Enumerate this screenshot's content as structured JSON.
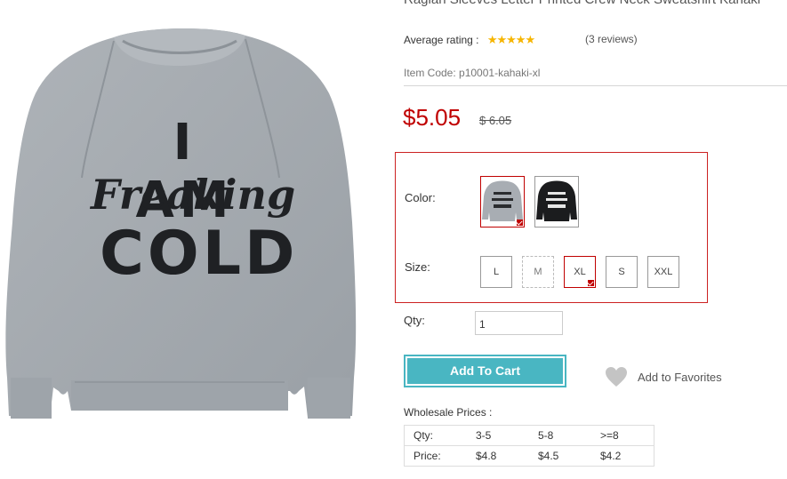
{
  "product": {
    "title": "Raglan Sleeves Letter Printed Crew Neck Sweatshirt Kahaki",
    "image_text": [
      "I AM",
      "Freaking",
      "COLD"
    ]
  },
  "rating": {
    "label": "Average rating :",
    "stars_value": 5,
    "stars_max": 5,
    "stars_display": "★★★★★",
    "reviews": "(3 reviews)"
  },
  "item_code": "Item Code: p10001-kahaki-xl",
  "price": {
    "current": "$5.05",
    "original": "$ 6.05"
  },
  "options": {
    "color_label": "Color:",
    "colors": [
      {
        "name": "gray",
        "selected": true,
        "print": [
          "I AM",
          "Freaking",
          "COLD"
        ]
      },
      {
        "name": "black",
        "selected": false,
        "print": [
          "I AM",
          "Freaking",
          "COLD"
        ]
      }
    ],
    "size_label": "Size:",
    "sizes": [
      {
        "label": "L",
        "state": "normal"
      },
      {
        "label": "M",
        "state": "disabled"
      },
      {
        "label": "XL",
        "state": "selected"
      },
      {
        "label": "S",
        "state": "normal"
      },
      {
        "label": "XXL",
        "state": "normal"
      }
    ]
  },
  "qty": {
    "label": "Qty:",
    "value": "1"
  },
  "cart": {
    "label": "Add To Cart"
  },
  "favorites": {
    "label": "Add to Favorites",
    "icon": "heart-icon"
  },
  "wholesale": {
    "title": "Wholesale Prices :",
    "rows": [
      [
        "Qty:",
        "3-5",
        "5-8",
        ">=8"
      ],
      [
        "Price:",
        "$4.8",
        "$4.5",
        "$4.2"
      ]
    ]
  },
  "colors": {
    "price_red": "#c00000",
    "cart_teal": "#49b6c2",
    "star_gold": "#f6b500",
    "sweater_gray": "#a4aab0",
    "option_border_red": "#cc2222"
  }
}
